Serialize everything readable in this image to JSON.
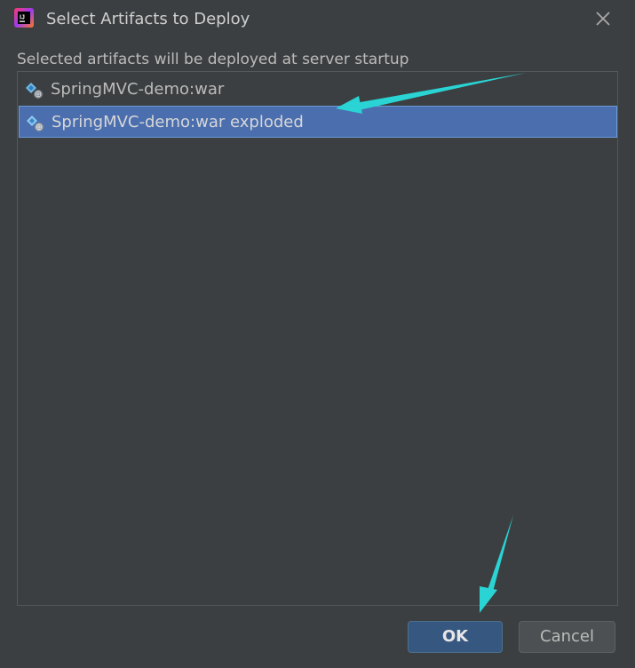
{
  "window": {
    "title": "Select Artifacts to Deploy",
    "app_icon": "intellij-idea-icon",
    "close_icon": "close-icon"
  },
  "subtitle": "Selected artifacts will be deployed at server startup",
  "artifacts": [
    {
      "label": "SpringMVC-demo:war",
      "icon": "artifact-war-icon",
      "selected": false
    },
    {
      "label": "SpringMVC-demo:war exploded",
      "icon": "artifact-war-exploded-icon",
      "selected": true
    }
  ],
  "buttons": {
    "ok_label": "OK",
    "cancel_label": "Cancel"
  },
  "colors": {
    "background": "#3c3f41",
    "selection": "#4b6eaf",
    "ok_button": "#365880",
    "annotation_arrow": "#2ad4d4"
  }
}
